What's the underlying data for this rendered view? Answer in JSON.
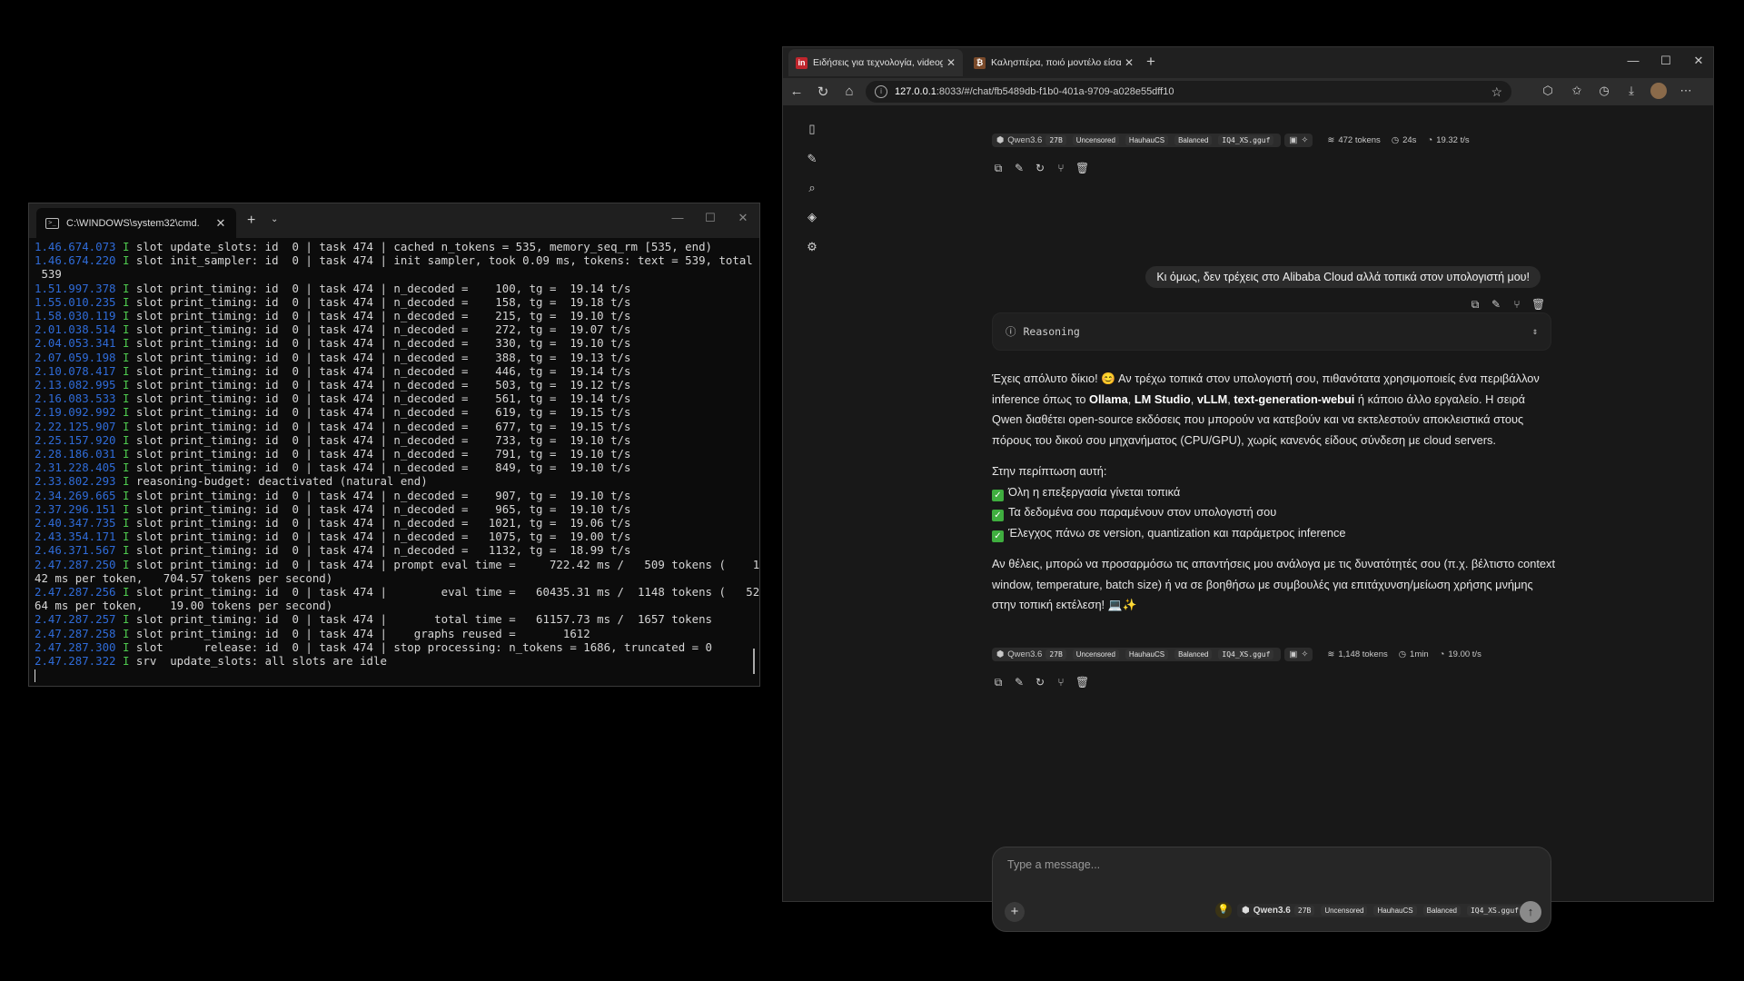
{
  "terminal": {
    "tab_title": "C:\\WINDOWS\\system32\\cmd.",
    "close": "✕",
    "new_tab": "+",
    "dropdown": "⌄",
    "minimize": "—",
    "maximize": "☐",
    "window_close": "✕",
    "lines": [
      {
        "ts": "1.46.674.073",
        "lvl": "I",
        "text": " slot update_slots: id  0 | task 474 | cached n_tokens = 535, memory_seq_rm [535, end)"
      },
      {
        "ts": "1.46.674.220",
        "lvl": "I",
        "text": " slot init_sampler: id  0 | task 474 | init sampler, took 0.09 ms, tokens: text = 539, total ="
      },
      {
        "ts": "",
        "lvl": "",
        "text": " 539"
      },
      {
        "ts": "1.51.997.378",
        "lvl": "I",
        "text": " slot print_timing: id  0 | task 474 | n_decoded =    100, tg =  19.14 t/s"
      },
      {
        "ts": "1.55.010.235",
        "lvl": "I",
        "text": " slot print_timing: id  0 | task 474 | n_decoded =    158, tg =  19.18 t/s"
      },
      {
        "ts": "1.58.030.119",
        "lvl": "I",
        "text": " slot print_timing: id  0 | task 474 | n_decoded =    215, tg =  19.10 t/s"
      },
      {
        "ts": "2.01.038.514",
        "lvl": "I",
        "text": " slot print_timing: id  0 | task 474 | n_decoded =    272, tg =  19.07 t/s"
      },
      {
        "ts": "2.04.053.341",
        "lvl": "I",
        "text": " slot print_timing: id  0 | task 474 | n_decoded =    330, tg =  19.10 t/s"
      },
      {
        "ts": "2.07.059.198",
        "lvl": "I",
        "text": " slot print_timing: id  0 | task 474 | n_decoded =    388, tg =  19.13 t/s"
      },
      {
        "ts": "2.10.078.417",
        "lvl": "I",
        "text": " slot print_timing: id  0 | task 474 | n_decoded =    446, tg =  19.14 t/s"
      },
      {
        "ts": "2.13.082.995",
        "lvl": "I",
        "text": " slot print_timing: id  0 | task 474 | n_decoded =    503, tg =  19.12 t/s"
      },
      {
        "ts": "2.16.083.533",
        "lvl": "I",
        "text": " slot print_timing: id  0 | task 474 | n_decoded =    561, tg =  19.14 t/s"
      },
      {
        "ts": "2.19.092.992",
        "lvl": "I",
        "text": " slot print_timing: id  0 | task 474 | n_decoded =    619, tg =  19.15 t/s"
      },
      {
        "ts": "2.22.125.907",
        "lvl": "I",
        "text": " slot print_timing: id  0 | task 474 | n_decoded =    677, tg =  19.15 t/s"
      },
      {
        "ts": "2.25.157.920",
        "lvl": "I",
        "text": " slot print_timing: id  0 | task 474 | n_decoded =    733, tg =  19.10 t/s"
      },
      {
        "ts": "2.28.186.031",
        "lvl": "I",
        "text": " slot print_timing: id  0 | task 474 | n_decoded =    791, tg =  19.10 t/s"
      },
      {
        "ts": "2.31.228.405",
        "lvl": "I",
        "text": " slot print_timing: id  0 | task 474 | n_decoded =    849, tg =  19.10 t/s"
      },
      {
        "ts": "2.33.802.293",
        "lvl": "I",
        "text": " reasoning-budget: deactivated (natural end)"
      },
      {
        "ts": "2.34.269.665",
        "lvl": "I",
        "text": " slot print_timing: id  0 | task 474 | n_decoded =    907, tg =  19.10 t/s"
      },
      {
        "ts": "2.37.296.151",
        "lvl": "I",
        "text": " slot print_timing: id  0 | task 474 | n_decoded =    965, tg =  19.10 t/s"
      },
      {
        "ts": "2.40.347.735",
        "lvl": "I",
        "text": " slot print_timing: id  0 | task 474 | n_decoded =   1021, tg =  19.06 t/s"
      },
      {
        "ts": "2.43.354.171",
        "lvl": "I",
        "text": " slot print_timing: id  0 | task 474 | n_decoded =   1075, tg =  19.00 t/s"
      },
      {
        "ts": "2.46.371.567",
        "lvl": "I",
        "text": " slot print_timing: id  0 | task 474 | n_decoded =   1132, tg =  18.99 t/s"
      },
      {
        "ts": "2.47.287.250",
        "lvl": "I",
        "text": " slot print_timing: id  0 | task 474 | prompt eval time =     722.42 ms /   509 tokens (    1."
      },
      {
        "ts": "",
        "lvl": "",
        "text": "42 ms per token,   704.57 tokens per second)"
      },
      {
        "ts": "2.47.287.256",
        "lvl": "I",
        "text": " slot print_timing: id  0 | task 474 |        eval time =   60435.31 ms /  1148 tokens (   52."
      },
      {
        "ts": "",
        "lvl": "",
        "text": "64 ms per token,    19.00 tokens per second)"
      },
      {
        "ts": "2.47.287.257",
        "lvl": "I",
        "text": " slot print_timing: id  0 | task 474 |       total time =   61157.73 ms /  1657 tokens"
      },
      {
        "ts": "2.47.287.258",
        "lvl": "I",
        "text": " slot print_timing: id  0 | task 474 |    graphs reused =       1612"
      },
      {
        "ts": "2.47.287.300",
        "lvl": "I",
        "text": " slot      release: id  0 | task 474 | stop processing: n_tokens = 1686, truncated = 0"
      },
      {
        "ts": "2.47.287.322",
        "lvl": "I",
        "text": " srv  update_slots: all slots are idle"
      }
    ]
  },
  "browser": {
    "tabs": [
      {
        "label": "Ειδήσεις για τεχνολογία, videogam",
        "favicon": "in",
        "favicon_color": "#c0262d",
        "active": true
      },
      {
        "label": "Καλησπέρα, ποιό μοντέλο είσαι κι",
        "favicon": "₿",
        "favicon_color": "#7a4a2a",
        "active": false
      }
    ],
    "new_tab": "+",
    "minimize": "—",
    "maximize": "☐",
    "close": "✕",
    "url_host": "127.0.0.1",
    "url_rest": ":8033/#/chat/fb5489db-f1b0-401a-9709-a028e55dff10"
  },
  "chat": {
    "model_meta_1": {
      "model": "Qwen3.6",
      "tags": [
        "27B",
        "Uncensored",
        "HauhauCS",
        "Balanced",
        "IQ4_XS.gguf"
      ],
      "tokens": "472 tokens",
      "time": "24s",
      "speed": "19.32 t/s"
    },
    "user_message": "Κι όμως, δεν τρέχεις στο Alibaba Cloud αλλά τοπικά στον υπολογιστή μου!",
    "reasoning_label": "Reasoning",
    "answer": {
      "p1_a": "Έχεις απόλυτο δίκιο! 😊 Αν τρέχω τοπικά στον υπολογιστή σου, πιθανότατα χρησιμοποιείς ένα περιβάλλον inference όπως το ",
      "p1_b1": "Ollama",
      "p1_sep1": ", ",
      "p1_b2": "LM Studio",
      "p1_sep2": ", ",
      "p1_b3": "vLLM",
      "p1_sep3": ", ",
      "p1_b4": "text-generation-webui",
      "p1_c": " ή κάποιο άλλο εργαλείο. Η σειρά Qwen διαθέτει open-source εκδόσεις που μπορούν να κατεβούν και να εκτελεστούν αποκλειστικά στους πόρους του δικού σου μηχανήματος (CPU/GPU), χωρίς κανενός είδους σύνδεση με cloud servers.",
      "p2": "Στην περίπτωση αυτή:",
      "bullets": [
        "Όλη η επεξεργασία γίνεται τοπικά",
        "Τα δεδομένα σου παραμένουν στον υπολογιστή σου",
        "Έλεγχος πάνω σε version, quantization και παράμετρος inference"
      ],
      "p3": "Αν θέλεις, μπορώ να προσαρμόσω τις απαντήσεις μου ανάλογα με τις δυνατότητές σου (π.χ. βέλτιστο context window, temperature, batch size) ή να σε βοηθήσω με συμβουλές για επιτάχυνση/μείωση χρήσης μνήμης στην τοπική εκτέλεση! 💻✨"
    },
    "model_meta_2": {
      "model": "Qwen3.6",
      "tags": [
        "27B",
        "Uncensored",
        "HauhauCS",
        "Balanced",
        "IQ4_XS.gguf"
      ],
      "tokens": "1,148 tokens",
      "time": "1min",
      "speed": "19.00 t/s"
    },
    "composer": {
      "placeholder": "Type a message...",
      "model": "Qwen3.6",
      "tags": [
        "27B",
        "Uncensored",
        "HauhauCS",
        "Balanced",
        "IQ4_XS.gguf"
      ]
    }
  }
}
